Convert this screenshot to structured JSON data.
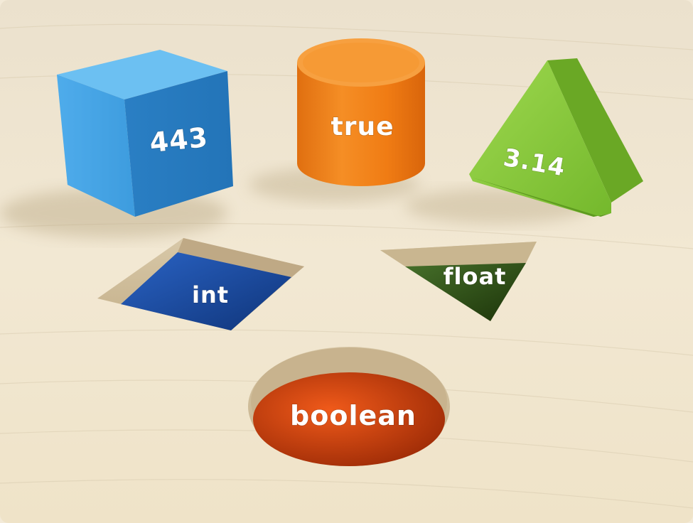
{
  "scene": {
    "blocks": [
      {
        "shape": "cube",
        "label": "443",
        "color": "#3d9fe0"
      },
      {
        "shape": "cylinder",
        "label": "true",
        "color": "#f0821a"
      },
      {
        "shape": "triangular-prism",
        "label": "3.14",
        "color": "#86c93a"
      }
    ],
    "holes": [
      {
        "shape": "square",
        "label": "int",
        "color": "#1a4fa8"
      },
      {
        "shape": "triangle",
        "label": "float",
        "color": "#2f4f16"
      },
      {
        "shape": "circle",
        "label": "boolean",
        "color": "#d8420e"
      }
    ],
    "surface": {
      "material": "light wood",
      "color": "#efe3c8"
    }
  }
}
